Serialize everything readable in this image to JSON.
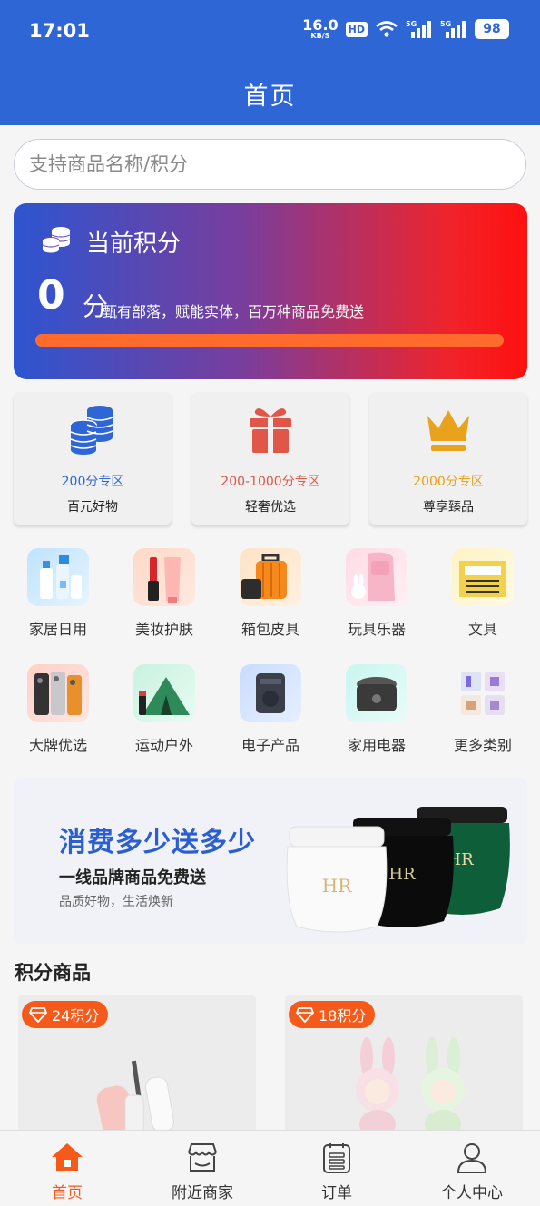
{
  "status_bar": {
    "time": "17:01",
    "net_speed": "16.0",
    "net_unit": "KB/S",
    "hd": "HD",
    "battery": "98"
  },
  "header": {
    "title": "首页"
  },
  "search": {
    "placeholder": "支持商品名称/积分",
    "value": ""
  },
  "points_card": {
    "title": "当前积分",
    "value": "0",
    "unit": "分",
    "slogan": "甄有部落，赋能实体，百万种商品免费送",
    "progress": 0
  },
  "zones": [
    {
      "range": "200分专区",
      "name": "百元好物",
      "icon": "coins-stack-icon",
      "color": "#2f66d6"
    },
    {
      "range": "200-1000分专区",
      "name": "轻奢优选",
      "icon": "gift-box-icon",
      "color": "#e0574a"
    },
    {
      "range": "2000分专区",
      "name": "尊享臻品",
      "icon": "crown-icon",
      "color": "#e8a21b"
    }
  ],
  "categories": [
    {
      "label": "家居日用",
      "icon": "cleaning-bottles-icon"
    },
    {
      "label": "美妆护肤",
      "icon": "cosmetics-icon"
    },
    {
      "label": "箱包皮具",
      "icon": "suitcase-icon"
    },
    {
      "label": "玩具乐器",
      "icon": "backpack-icon"
    },
    {
      "label": "文具",
      "icon": "stationery-icon"
    },
    {
      "label": "大牌优选",
      "icon": "phones-icon"
    },
    {
      "label": "运动户外",
      "icon": "tent-icon"
    },
    {
      "label": "电子产品",
      "icon": "speaker-icon"
    },
    {
      "label": "家用电器",
      "icon": "rice-cooker-icon"
    },
    {
      "label": "更多类别",
      "icon": "more-grid-icon"
    }
  ],
  "banner": {
    "title": "消费多少送多少",
    "subtitle": "一线品牌商品免费送",
    "note": "品质好物，生活焕新"
  },
  "section": {
    "title": "积分商品"
  },
  "products": [
    {
      "points": "24积分"
    },
    {
      "points": "18积分"
    }
  ],
  "tabbar": [
    {
      "label": "首页",
      "icon": "home-icon",
      "active": true
    },
    {
      "label": "附近商家",
      "icon": "store-icon",
      "active": false
    },
    {
      "label": "订单",
      "icon": "order-list-icon",
      "active": false
    },
    {
      "label": "个人中心",
      "icon": "user-icon",
      "active": false
    }
  ],
  "colors": {
    "primary": "#2f66d6",
    "accent": "#f55a1b"
  }
}
